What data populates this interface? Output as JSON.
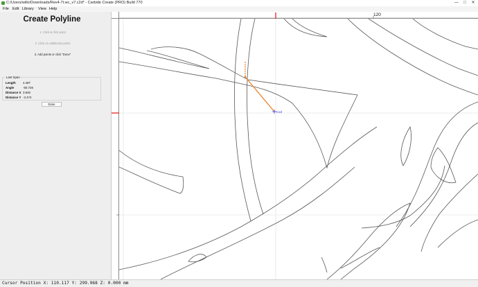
{
  "window": {
    "title": "C:/Users/willo/Downloads/Rev4-7t.wc_v7.c2d* - Carbide Create (PRO) Build 770",
    "minimize_glyph": "—",
    "maximize_glyph": "□",
    "close_glyph": "✕"
  },
  "menu": {
    "items": [
      "File",
      "Edit",
      "Library",
      "View",
      "Help"
    ]
  },
  "panel": {
    "title": "Create Polyline",
    "steps": [
      "1. Click on first point",
      "2. Click on additional points",
      "3. Add points or click \"Done\""
    ],
    "active_step": 3,
    "last_span": {
      "legend": "Last Span",
      "rows": [
        {
          "label": "Length",
          "value": "4.487"
        },
        {
          "label": "Angle",
          "value": "-50.726"
        },
        {
          "label": "Distance X",
          "value": "3.845"
        },
        {
          "label": "Distance Y",
          "value": "-3.474"
        }
      ]
    },
    "done_label": "Done"
  },
  "ruler": {
    "top_label": "120"
  },
  "canvas": {
    "cursor_label": "Cxd",
    "colors": {
      "vector": "#555555",
      "polyline": "#e8822e",
      "cursor": "#3a3ad6",
      "origin_marker": "#dd1111",
      "grid": "#dddddd"
    }
  },
  "status": {
    "text": "Cursor Position X: 110.117 Y: 299.968 Z: 0.000 mm"
  }
}
